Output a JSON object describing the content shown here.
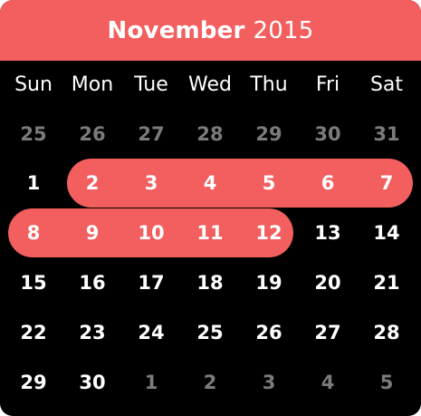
{
  "header": {
    "month": "November",
    "year": "2015"
  },
  "weekdays": [
    "Sun",
    "Mon",
    "Tue",
    "Wed",
    "Thu",
    "Fri",
    "Sat"
  ],
  "weeks": [
    [
      "25",
      "26",
      "27",
      "28",
      "29",
      "30",
      "31"
    ],
    [
      "1",
      "2",
      "3",
      "4",
      "5",
      "6",
      "7"
    ],
    [
      "8",
      "9",
      "10",
      "11",
      "12",
      "13",
      "14"
    ],
    [
      "15",
      "16",
      "17",
      "18",
      "19",
      "20",
      "21"
    ],
    [
      "22",
      "23",
      "24",
      "25",
      "26",
      "27",
      "28"
    ],
    [
      "29",
      "30",
      "1",
      "2",
      "3",
      "4",
      "5"
    ]
  ],
  "selection": {
    "start": "2",
    "end": "12"
  },
  "colors": {
    "accent": "#f35e5f",
    "background": "#000000",
    "text": "#ffffff",
    "muted": "#7b7b7b"
  }
}
